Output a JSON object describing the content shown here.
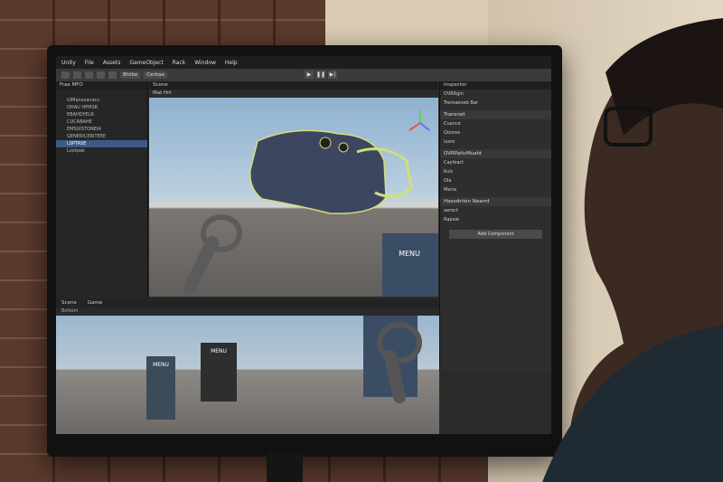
{
  "menubar": {
    "items": [
      "Unity",
      "File",
      "Assets",
      "GameObject",
      "Rack",
      "Window",
      "Help"
    ]
  },
  "toolbar": {
    "label1": "Bhtbe",
    "label2": "Centaa"
  },
  "playbar": {
    "play": "▶",
    "pause": "❚❚",
    "step": "▶|"
  },
  "hierarchy": {
    "title": "Hierarchy",
    "search": "Frae MFO",
    "items": [
      "UIManasanacs",
      "OHAU HPMSR",
      "EBAHDYELR",
      "CUCABAHE",
      "EMSUISTONEIA",
      "GENERICERITEEE",
      "LSPTASE",
      "Lootpak"
    ]
  },
  "scene": {
    "tab_scene": "Scene",
    "tab_game": "Game",
    "bar_label": "Mat Hrt",
    "gizmo": "Persp"
  },
  "inspector": {
    "title": "Inspector",
    "object": "OVRRgin",
    "tag": "Tremaeneb Bar",
    "sections": [
      {
        "name": "Transnet",
        "rows": [
          "Cuance",
          "Oooree",
          "lusre"
        ]
      },
      {
        "name": "OVRPaticMuaht",
        "rows": [
          "Cayfeact",
          "Kulc",
          "Ola",
          "Maria"
        ]
      },
      {
        "name": "Hasodrtion Nearrd",
        "rows": [
          "aerect",
          "Rapaie"
        ]
      }
    ],
    "button": "Add Component"
  },
  "game": {
    "tab1": "Scene",
    "tab2": "Game",
    "bar": "Bottom",
    "menu_label": "MENU"
  },
  "scene_menu": "MENU"
}
